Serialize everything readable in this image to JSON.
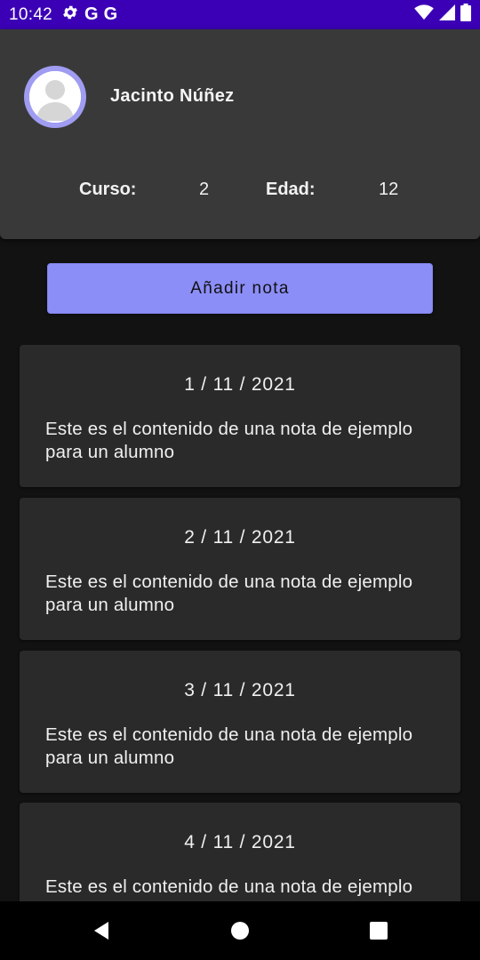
{
  "status_bar": {
    "time": "10:42",
    "left_icons": [
      "gear-icon",
      "google-icon",
      "google-icon"
    ],
    "google_glyph": "G",
    "right_icons": [
      "wifi-icon",
      "signal-icon",
      "battery-icon"
    ]
  },
  "profile": {
    "name": "Jacinto Núñez",
    "curso_label": "Curso:",
    "curso_value": "2",
    "edad_label": "Edad:",
    "edad_value": "12",
    "avatar_icon": "person-icon"
  },
  "actions": {
    "add_note_label": "Añadir nota"
  },
  "notes": [
    {
      "date": "1 / 11 / 2021",
      "content": "Este es el contenido de una nota de ejemplo para un alumno"
    },
    {
      "date": "2 / 11 / 2021",
      "content": "Este es el contenido de una nota de ejemplo para un alumno"
    },
    {
      "date": "3 / 11 / 2021",
      "content": "Este es el contenido de una nota de ejemplo para un alumno"
    },
    {
      "date": "4 / 11 / 2021",
      "content": "Este es el contenido de una nota de ejemplo para un alumno"
    }
  ],
  "colors": {
    "status_bar": "#3b00b5",
    "accent": "#8c8ef8",
    "card": "#2a2a2a",
    "background": "#121212",
    "profile_card": "#393939"
  },
  "nav_icons": [
    "back-icon",
    "home-icon",
    "recents-icon"
  ]
}
